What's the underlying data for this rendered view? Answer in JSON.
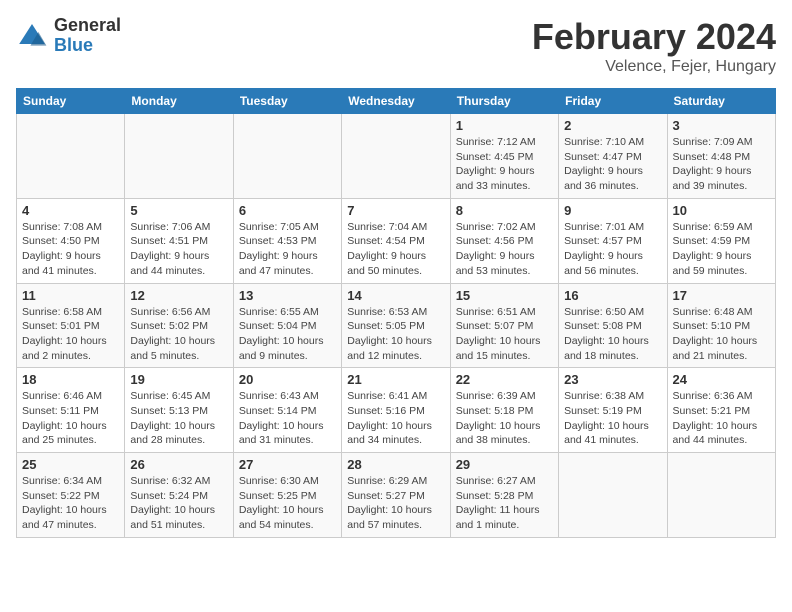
{
  "logo": {
    "general": "General",
    "blue": "Blue"
  },
  "header": {
    "month": "February 2024",
    "location": "Velence, Fejer, Hungary"
  },
  "weekdays": [
    "Sunday",
    "Monday",
    "Tuesday",
    "Wednesday",
    "Thursday",
    "Friday",
    "Saturday"
  ],
  "weeks": [
    [
      {
        "day": "",
        "sunrise": "",
        "sunset": "",
        "daylight": ""
      },
      {
        "day": "",
        "sunrise": "",
        "sunset": "",
        "daylight": ""
      },
      {
        "day": "",
        "sunrise": "",
        "sunset": "",
        "daylight": ""
      },
      {
        "day": "",
        "sunrise": "",
        "sunset": "",
        "daylight": ""
      },
      {
        "day": "1",
        "sunrise": "Sunrise: 7:12 AM",
        "sunset": "Sunset: 4:45 PM",
        "daylight": "Daylight: 9 hours and 33 minutes."
      },
      {
        "day": "2",
        "sunrise": "Sunrise: 7:10 AM",
        "sunset": "Sunset: 4:47 PM",
        "daylight": "Daylight: 9 hours and 36 minutes."
      },
      {
        "day": "3",
        "sunrise": "Sunrise: 7:09 AM",
        "sunset": "Sunset: 4:48 PM",
        "daylight": "Daylight: 9 hours and 39 minutes."
      }
    ],
    [
      {
        "day": "4",
        "sunrise": "Sunrise: 7:08 AM",
        "sunset": "Sunset: 4:50 PM",
        "daylight": "Daylight: 9 hours and 41 minutes."
      },
      {
        "day": "5",
        "sunrise": "Sunrise: 7:06 AM",
        "sunset": "Sunset: 4:51 PM",
        "daylight": "Daylight: 9 hours and 44 minutes."
      },
      {
        "day": "6",
        "sunrise": "Sunrise: 7:05 AM",
        "sunset": "Sunset: 4:53 PM",
        "daylight": "Daylight: 9 hours and 47 minutes."
      },
      {
        "day": "7",
        "sunrise": "Sunrise: 7:04 AM",
        "sunset": "Sunset: 4:54 PM",
        "daylight": "Daylight: 9 hours and 50 minutes."
      },
      {
        "day": "8",
        "sunrise": "Sunrise: 7:02 AM",
        "sunset": "Sunset: 4:56 PM",
        "daylight": "Daylight: 9 hours and 53 minutes."
      },
      {
        "day": "9",
        "sunrise": "Sunrise: 7:01 AM",
        "sunset": "Sunset: 4:57 PM",
        "daylight": "Daylight: 9 hours and 56 minutes."
      },
      {
        "day": "10",
        "sunrise": "Sunrise: 6:59 AM",
        "sunset": "Sunset: 4:59 PM",
        "daylight": "Daylight: 9 hours and 59 minutes."
      }
    ],
    [
      {
        "day": "11",
        "sunrise": "Sunrise: 6:58 AM",
        "sunset": "Sunset: 5:01 PM",
        "daylight": "Daylight: 10 hours and 2 minutes."
      },
      {
        "day": "12",
        "sunrise": "Sunrise: 6:56 AM",
        "sunset": "Sunset: 5:02 PM",
        "daylight": "Daylight: 10 hours and 5 minutes."
      },
      {
        "day": "13",
        "sunrise": "Sunrise: 6:55 AM",
        "sunset": "Sunset: 5:04 PM",
        "daylight": "Daylight: 10 hours and 9 minutes."
      },
      {
        "day": "14",
        "sunrise": "Sunrise: 6:53 AM",
        "sunset": "Sunset: 5:05 PM",
        "daylight": "Daylight: 10 hours and 12 minutes."
      },
      {
        "day": "15",
        "sunrise": "Sunrise: 6:51 AM",
        "sunset": "Sunset: 5:07 PM",
        "daylight": "Daylight: 10 hours and 15 minutes."
      },
      {
        "day": "16",
        "sunrise": "Sunrise: 6:50 AM",
        "sunset": "Sunset: 5:08 PM",
        "daylight": "Daylight: 10 hours and 18 minutes."
      },
      {
        "day": "17",
        "sunrise": "Sunrise: 6:48 AM",
        "sunset": "Sunset: 5:10 PM",
        "daylight": "Daylight: 10 hours and 21 minutes."
      }
    ],
    [
      {
        "day": "18",
        "sunrise": "Sunrise: 6:46 AM",
        "sunset": "Sunset: 5:11 PM",
        "daylight": "Daylight: 10 hours and 25 minutes."
      },
      {
        "day": "19",
        "sunrise": "Sunrise: 6:45 AM",
        "sunset": "Sunset: 5:13 PM",
        "daylight": "Daylight: 10 hours and 28 minutes."
      },
      {
        "day": "20",
        "sunrise": "Sunrise: 6:43 AM",
        "sunset": "Sunset: 5:14 PM",
        "daylight": "Daylight: 10 hours and 31 minutes."
      },
      {
        "day": "21",
        "sunrise": "Sunrise: 6:41 AM",
        "sunset": "Sunset: 5:16 PM",
        "daylight": "Daylight: 10 hours and 34 minutes."
      },
      {
        "day": "22",
        "sunrise": "Sunrise: 6:39 AM",
        "sunset": "Sunset: 5:18 PM",
        "daylight": "Daylight: 10 hours and 38 minutes."
      },
      {
        "day": "23",
        "sunrise": "Sunrise: 6:38 AM",
        "sunset": "Sunset: 5:19 PM",
        "daylight": "Daylight: 10 hours and 41 minutes."
      },
      {
        "day": "24",
        "sunrise": "Sunrise: 6:36 AM",
        "sunset": "Sunset: 5:21 PM",
        "daylight": "Daylight: 10 hours and 44 minutes."
      }
    ],
    [
      {
        "day": "25",
        "sunrise": "Sunrise: 6:34 AM",
        "sunset": "Sunset: 5:22 PM",
        "daylight": "Daylight: 10 hours and 47 minutes."
      },
      {
        "day": "26",
        "sunrise": "Sunrise: 6:32 AM",
        "sunset": "Sunset: 5:24 PM",
        "daylight": "Daylight: 10 hours and 51 minutes."
      },
      {
        "day": "27",
        "sunrise": "Sunrise: 6:30 AM",
        "sunset": "Sunset: 5:25 PM",
        "daylight": "Daylight: 10 hours and 54 minutes."
      },
      {
        "day": "28",
        "sunrise": "Sunrise: 6:29 AM",
        "sunset": "Sunset: 5:27 PM",
        "daylight": "Daylight: 10 hours and 57 minutes."
      },
      {
        "day": "29",
        "sunrise": "Sunrise: 6:27 AM",
        "sunset": "Sunset: 5:28 PM",
        "daylight": "Daylight: 11 hours and 1 minute."
      },
      {
        "day": "",
        "sunrise": "",
        "sunset": "",
        "daylight": ""
      },
      {
        "day": "",
        "sunrise": "",
        "sunset": "",
        "daylight": ""
      }
    ]
  ]
}
